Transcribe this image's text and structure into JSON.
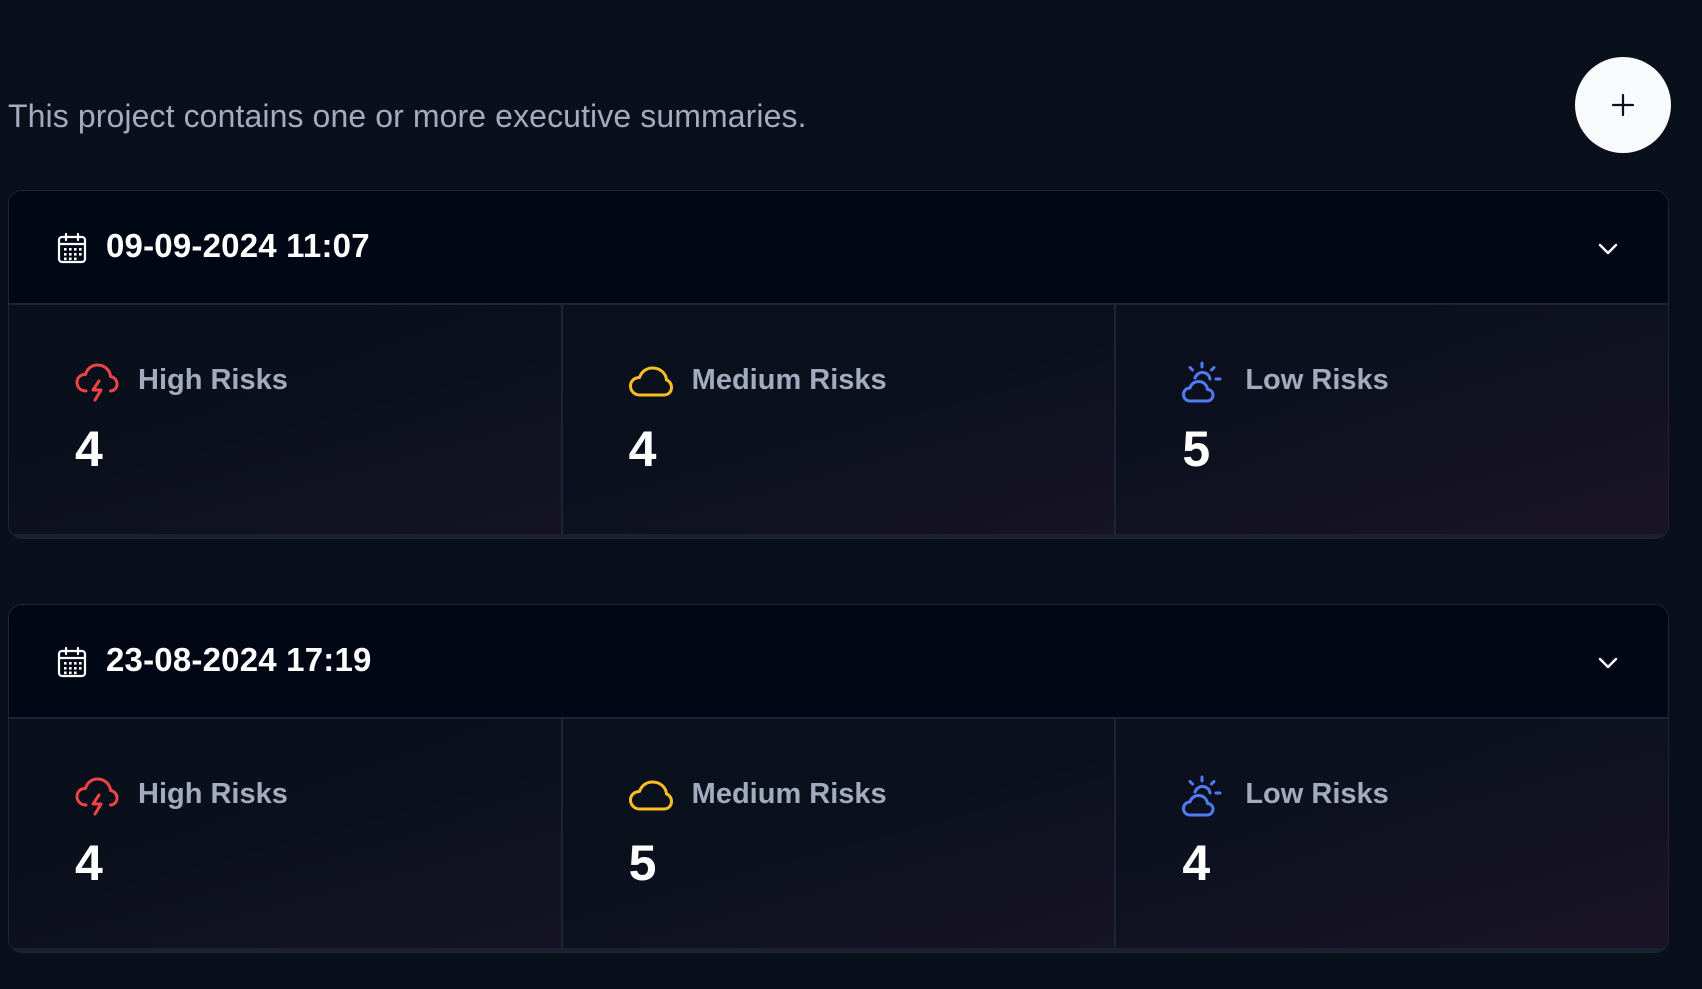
{
  "intro": {
    "text": "This project contains one or more executive summaries."
  },
  "add_button": {
    "icon": "plus-icon"
  },
  "colors": {
    "background": "#0a0f1c",
    "high": "#ef4444",
    "medium": "#fbbf24",
    "low": "#4f7cf3",
    "muted_text": "#a3abbe"
  },
  "summaries": [
    {
      "date": "09-09-2024 11:07",
      "stats": [
        {
          "icon": "storm-cloud-icon",
          "label": "High Risks",
          "value": "4"
        },
        {
          "icon": "cloud-icon",
          "label": "Medium Risks",
          "value": "4"
        },
        {
          "icon": "sun-cloud-icon",
          "label": "Low Risks",
          "value": "5"
        }
      ]
    },
    {
      "date": "23-08-2024 17:19",
      "stats": [
        {
          "icon": "storm-cloud-icon",
          "label": "High Risks",
          "value": "4"
        },
        {
          "icon": "cloud-icon",
          "label": "Medium Risks",
          "value": "5"
        },
        {
          "icon": "sun-cloud-icon",
          "label": "Low Risks",
          "value": "4"
        }
      ]
    }
  ]
}
